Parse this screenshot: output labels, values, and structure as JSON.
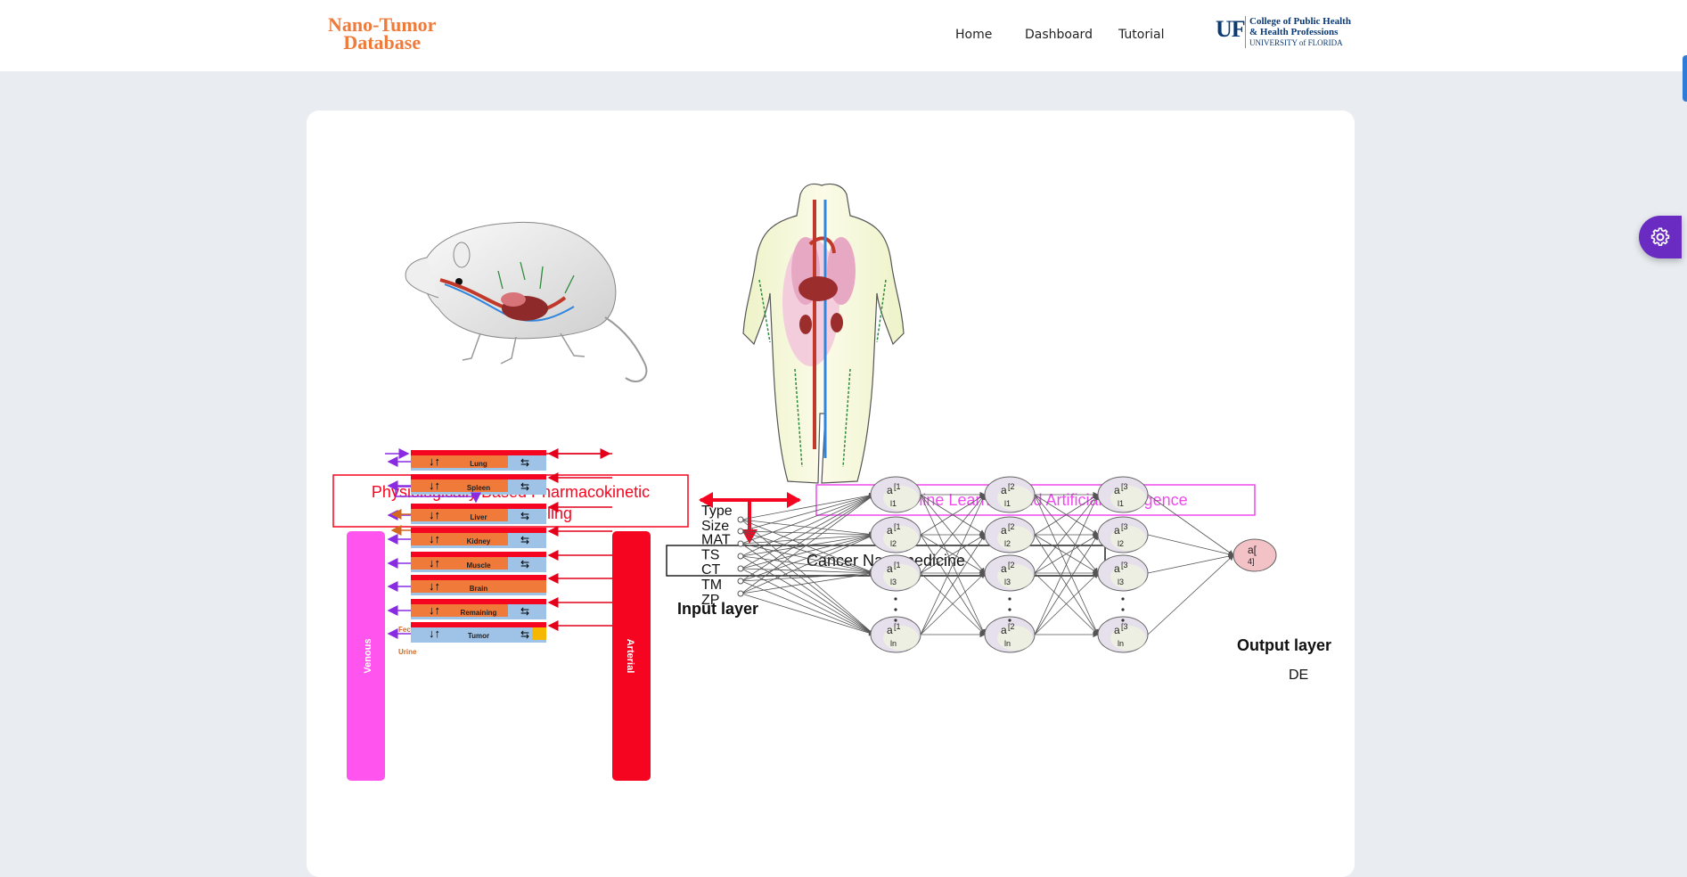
{
  "header": {
    "logo": {
      "line1": "Nano-Tumor",
      "line2": "Database"
    },
    "nav": [
      {
        "label": "Home"
      },
      {
        "label": "Dashboard"
      },
      {
        "label": "Tutorial"
      }
    ],
    "affiliation": {
      "mark": "UF",
      "line1": "College of Public Health",
      "line2": "& Health Professions",
      "line3": "UNIVERSITY of FLORIDA"
    }
  },
  "figure": {
    "pbpk_title_line1": "Physiologically Based Pharmacokinetic",
    "pbpk_title_line2": "(PBPK) Modeling",
    "ml_title": "Machine Learning and Artificial Intelligence",
    "cancer_title": "Cancer Nanomedicine",
    "venous_label": "Venous",
    "arterial_label": "Arterial",
    "feces_label": "Feces",
    "urine_label": "Urine",
    "compartments": [
      "Lung",
      "Spleen",
      "Liver",
      "Kidney",
      "Muscle",
      "Brain",
      "Remaining",
      "Tumor"
    ],
    "input_layer_label": "Input layer",
    "inputs": [
      "Type",
      "Size",
      "MAT",
      "TS",
      "CT",
      "TM",
      "ZP"
    ],
    "output_layer_label": "Output layer",
    "output_label": "DE",
    "output_node": {
      "top": "a[",
      "sub": "4]"
    },
    "hidden_layers": [
      {
        "sup": "[1",
        "subs": [
          "1",
          "2",
          "3",
          "n"
        ]
      },
      {
        "sup": "[2",
        "subs": [
          "1",
          "2",
          "3",
          "n"
        ]
      },
      {
        "sup": "[3",
        "subs": [
          "1",
          "2",
          "3",
          "n"
        ]
      }
    ]
  },
  "colors": {
    "logo_orange": "#ee7b3c",
    "uf_blue": "#0b3a75",
    "pbpk_red": "#f5051f",
    "ml_magenta": "#ef49ef",
    "venous_pink": "#ff55ee",
    "settings_purple": "#6a2bc2"
  },
  "icons": {
    "settings": "gear-icon"
  }
}
